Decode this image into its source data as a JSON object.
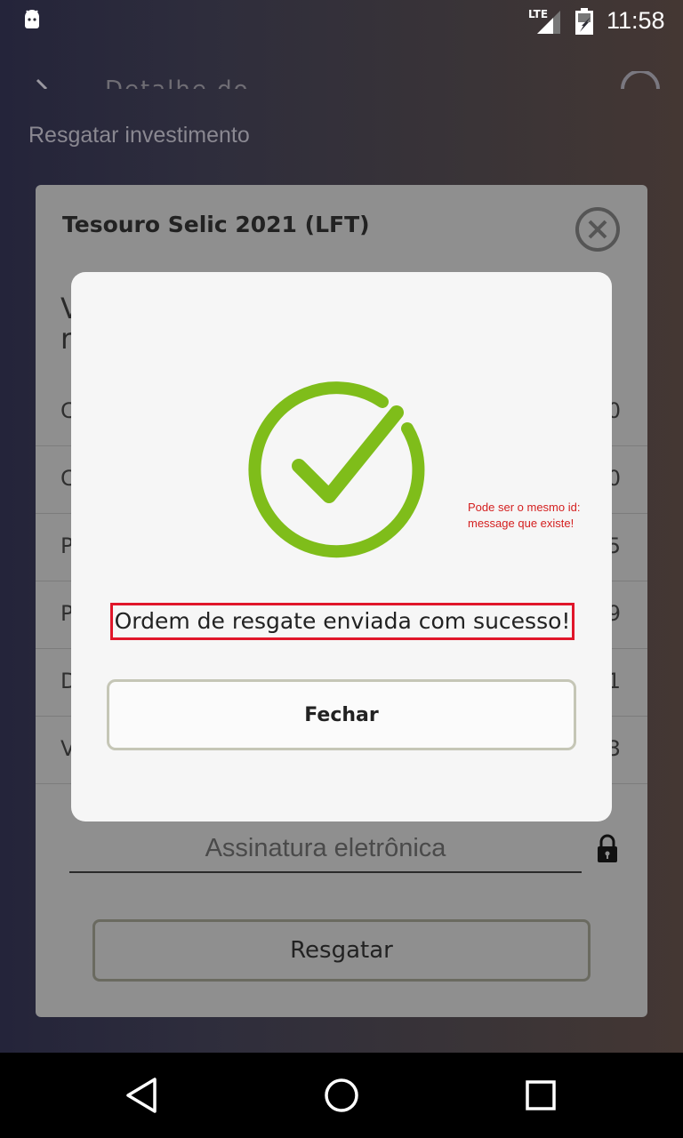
{
  "status_bar": {
    "network": "LTE",
    "time": "11:58"
  },
  "toolbar": {
    "title_ghost": "Detalhe do investimento"
  },
  "subtitle": "Resgatar investimento",
  "card": {
    "title": "Tesouro Selic 2021 (LFT)",
    "heading_fragment_1": "V",
    "heading_fragment_2": "r",
    "rows": [
      {
        "label": "C",
        "value": "0"
      },
      {
        "label": "C",
        "value": "0"
      },
      {
        "label": "P",
        "value": "5"
      },
      {
        "label": "P",
        "value": "9"
      },
      {
        "label": "D",
        "value": "1"
      },
      {
        "label": "V",
        "value": "3"
      }
    ],
    "signature_placeholder": "Assinatura eletrônica",
    "submit_label": "Resgatar"
  },
  "modal": {
    "annotation": "Pode ser o mesmo id: message que existe!",
    "message": "Ordem de resgate enviada com sucesso!",
    "close_label": "Fechar",
    "accent_color": "#7fbd1a"
  },
  "icons": {
    "status": [
      "android-icon",
      "signal-icon",
      "battery-icon"
    ],
    "nav": [
      "back-icon",
      "home-icon",
      "recents-icon"
    ]
  }
}
